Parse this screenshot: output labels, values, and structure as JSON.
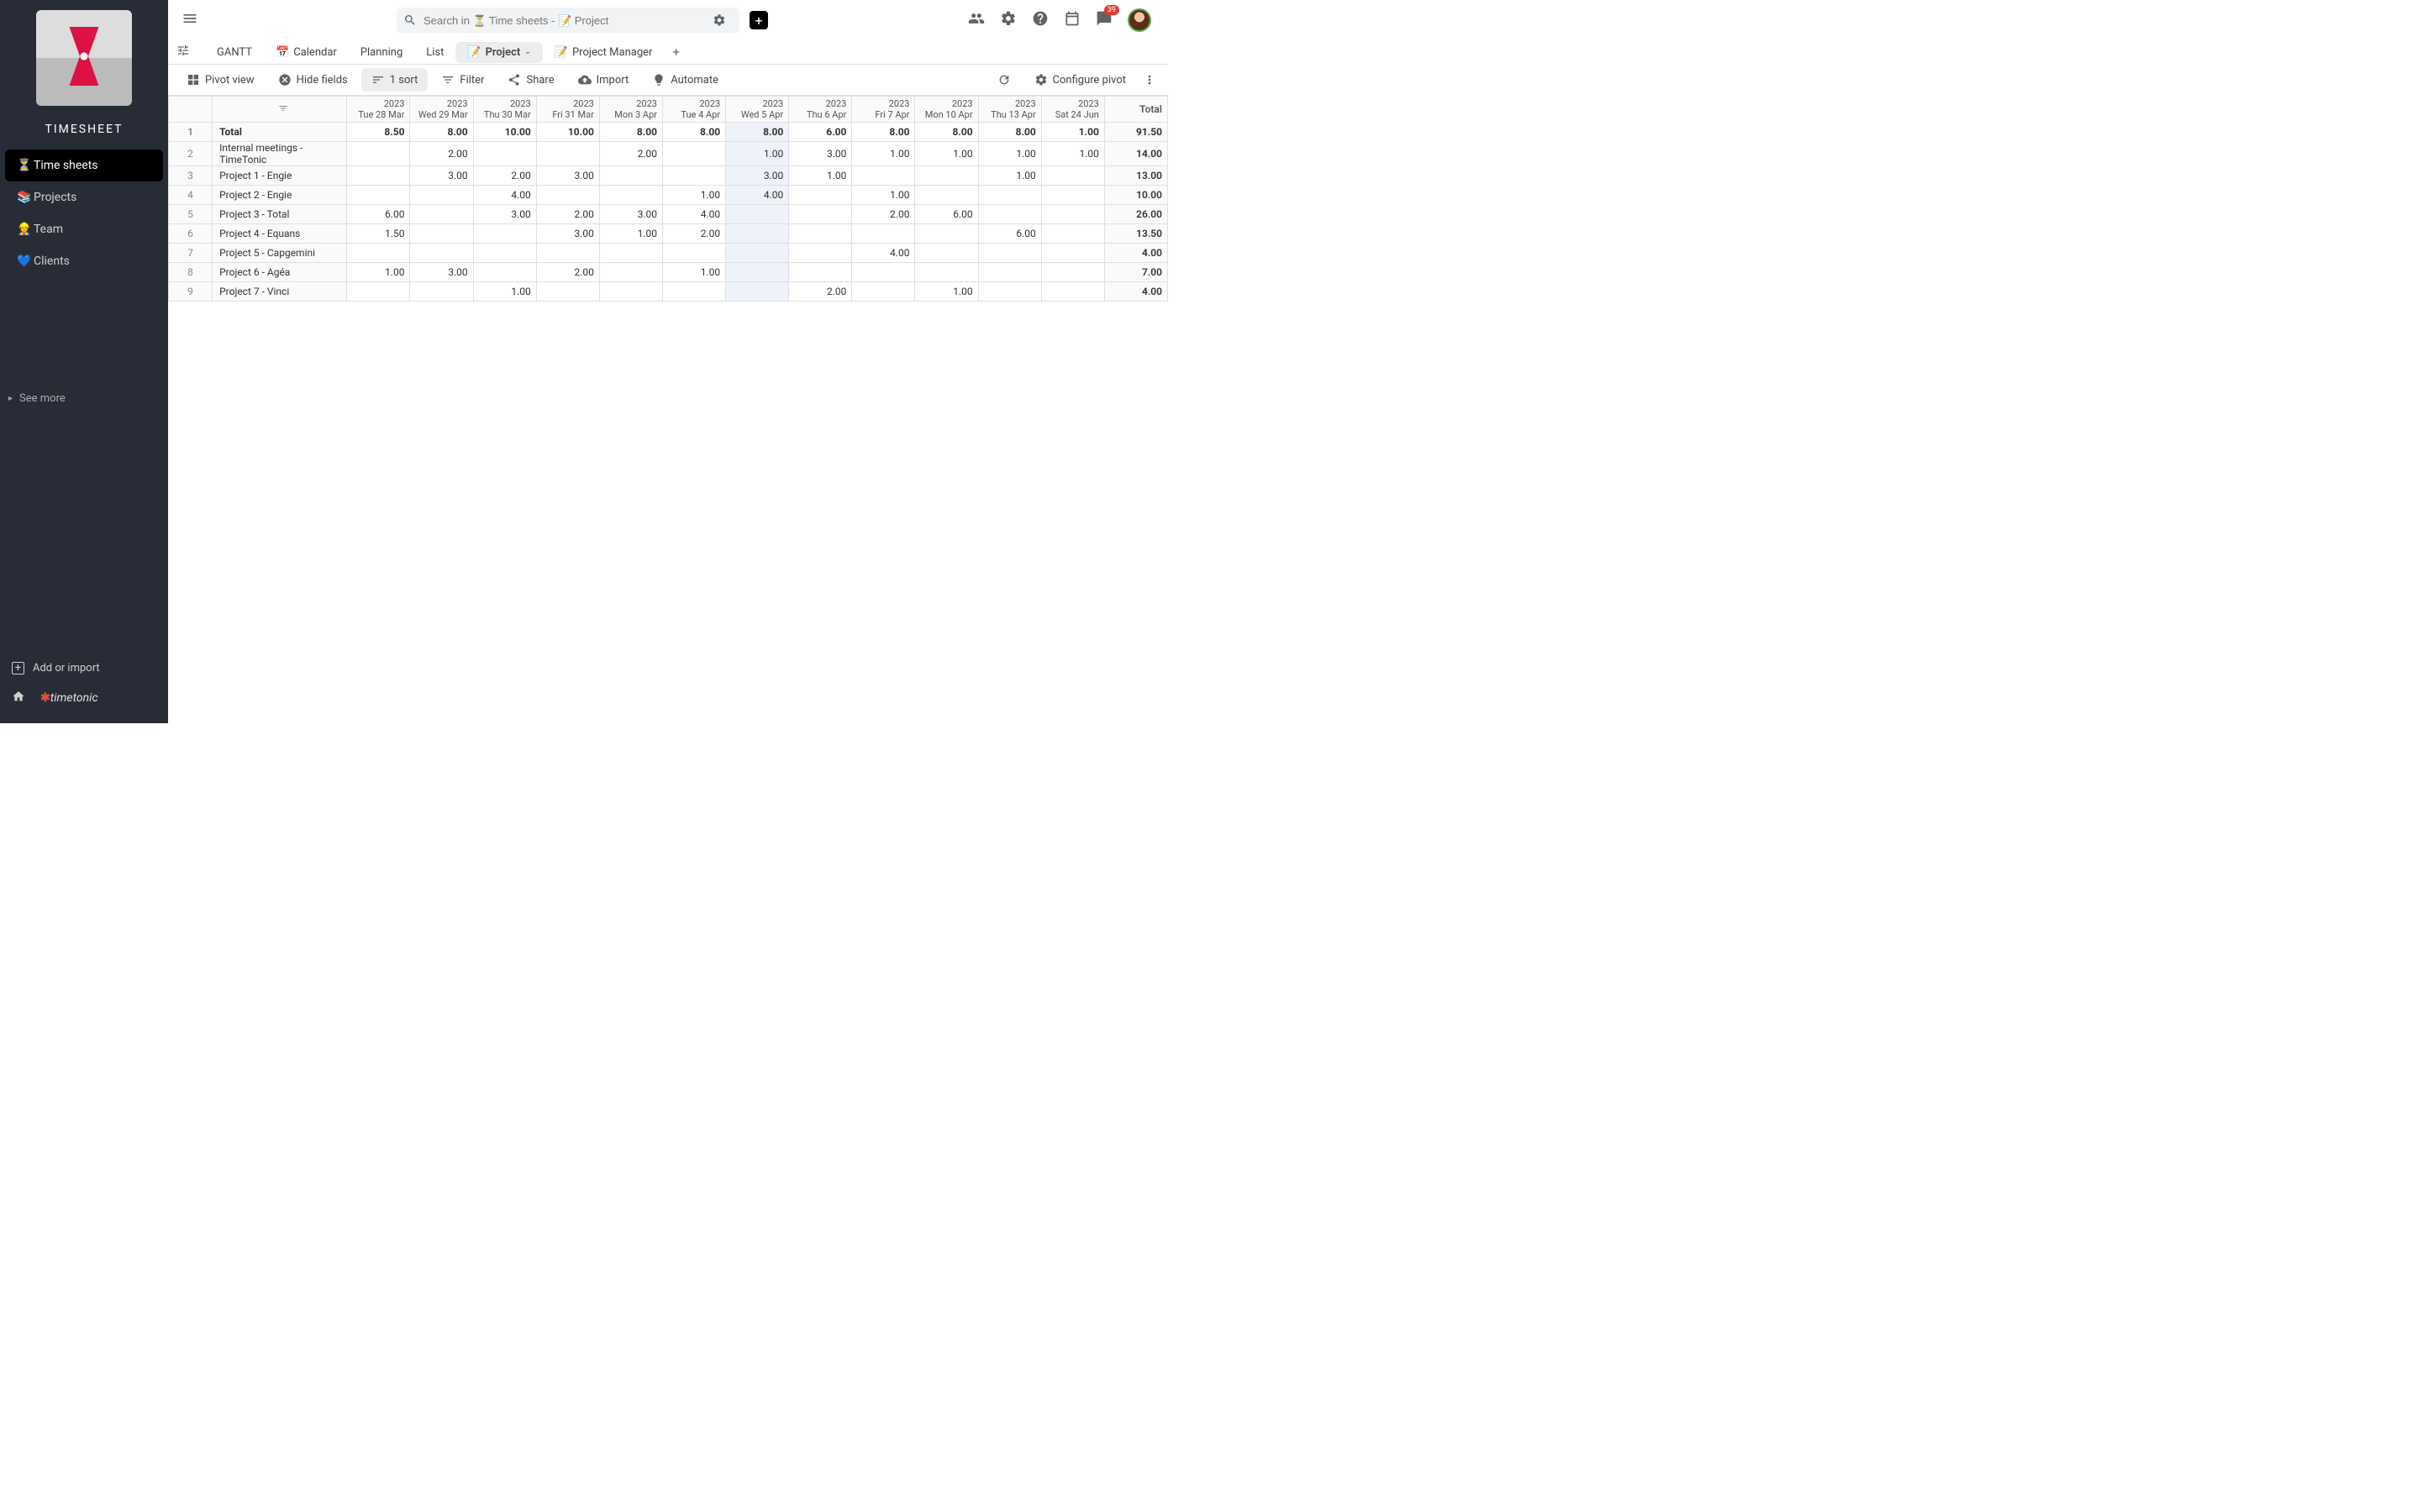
{
  "sidebar": {
    "title": "TIMESHEET",
    "items": [
      {
        "icon": "⏳",
        "label": "Time sheets",
        "active": true
      },
      {
        "icon": "📚",
        "label": "Projects",
        "active": false
      },
      {
        "icon": "👷‍♀️",
        "label": "Team",
        "active": false
      },
      {
        "icon": "💙",
        "label": "Clients",
        "active": false
      }
    ],
    "see_more": "See more",
    "add_or_import": "Add or import",
    "brand_html": "timetonic"
  },
  "topbar": {
    "search_placeholder": "Search in ⏳ Time sheets - 📝 Project",
    "notification_count": "39"
  },
  "tabs": [
    {
      "label": "GANTT",
      "icon": "",
      "active": false
    },
    {
      "label": "Calendar",
      "icon": "📅",
      "active": false
    },
    {
      "label": "Planning",
      "icon": "",
      "active": false
    },
    {
      "label": "List",
      "icon": "",
      "active": false
    },
    {
      "label": "Project",
      "icon": "📝",
      "active": true,
      "dropdown": true
    },
    {
      "label": "Project Manager",
      "icon": "📝",
      "active": false
    }
  ],
  "toolbar": {
    "pivot_view": "Pivot view",
    "hide_fields": "Hide fields",
    "sort": "1 sort",
    "filter": "Filter",
    "share": "Share",
    "import": "Import",
    "automate": "Automate",
    "configure_pivot": "Configure pivot"
  },
  "table": {
    "columns": [
      {
        "year": "2023",
        "day": "Tue 28 Mar"
      },
      {
        "year": "2023",
        "day": "Wed 29 Mar"
      },
      {
        "year": "2023",
        "day": "Thu 30 Mar"
      },
      {
        "year": "2023",
        "day": "Fri 31 Mar"
      },
      {
        "year": "2023",
        "day": "Mon 3 Apr"
      },
      {
        "year": "2023",
        "day": "Tue 4 Apr"
      },
      {
        "year": "2023",
        "day": "Wed 5 Apr"
      },
      {
        "year": "2023",
        "day": "Thu 6 Apr"
      },
      {
        "year": "2023",
        "day": "Fri 7 Apr"
      },
      {
        "year": "2023",
        "day": "Mon 10 Apr"
      },
      {
        "year": "2023",
        "day": "Thu 13 Apr"
      },
      {
        "year": "2023",
        "day": "Sat 24 Jun"
      }
    ],
    "total_label": "Total",
    "highlight_col": 6,
    "rows": [
      {
        "num": "1",
        "label": "Total",
        "cells": [
          "8.50",
          "8.00",
          "10.00",
          "10.00",
          "8.00",
          "8.00",
          "8.00",
          "6.00",
          "8.00",
          "8.00",
          "8.00",
          "1.00"
        ],
        "total": "91.50",
        "bold": true
      },
      {
        "num": "2",
        "label": "Internal meetings - TimeTonic",
        "cells": [
          "",
          "2.00",
          "",
          "",
          "2.00",
          "",
          "1.00",
          "3.00",
          "1.00",
          "1.00",
          "1.00",
          "1.00"
        ],
        "total": "14.00"
      },
      {
        "num": "3",
        "label": "Project 1 - Engie",
        "cells": [
          "",
          "3.00",
          "2.00",
          "3.00",
          "",
          "",
          "3.00",
          "1.00",
          "",
          "",
          "1.00",
          ""
        ],
        "total": "13.00"
      },
      {
        "num": "4",
        "label": "Project 2 - Engie",
        "cells": [
          "",
          "",
          "4.00",
          "",
          "",
          "1.00",
          "4.00",
          "",
          "1.00",
          "",
          "",
          ""
        ],
        "total": "10.00"
      },
      {
        "num": "5",
        "label": "Project 3 - Total",
        "cells": [
          "6.00",
          "",
          "3.00",
          "2.00",
          "3.00",
          "4.00",
          "",
          "",
          "2.00",
          "6.00",
          "",
          ""
        ],
        "total": "26.00"
      },
      {
        "num": "6",
        "label": "Project 4 - Equans",
        "cells": [
          "1.50",
          "",
          "",
          "3.00",
          "1.00",
          "2.00",
          "",
          "",
          "",
          "",
          "6.00",
          ""
        ],
        "total": "13.50"
      },
      {
        "num": "7",
        "label": "Project 5 - Capgemini",
        "cells": [
          "",
          "",
          "",
          "",
          "",
          "",
          "",
          "",
          "4.00",
          "",
          "",
          ""
        ],
        "total": "4.00"
      },
      {
        "num": "8",
        "label": "Project 6 - Agéa",
        "cells": [
          "1.00",
          "3.00",
          "",
          "2.00",
          "",
          "1.00",
          "",
          "",
          "",
          "",
          "",
          ""
        ],
        "total": "7.00"
      },
      {
        "num": "9",
        "label": "Project 7 - Vinci",
        "cells": [
          "",
          "",
          "1.00",
          "",
          "",
          "",
          "",
          "2.00",
          "",
          "1.00",
          "",
          ""
        ],
        "total": "4.00"
      }
    ]
  }
}
